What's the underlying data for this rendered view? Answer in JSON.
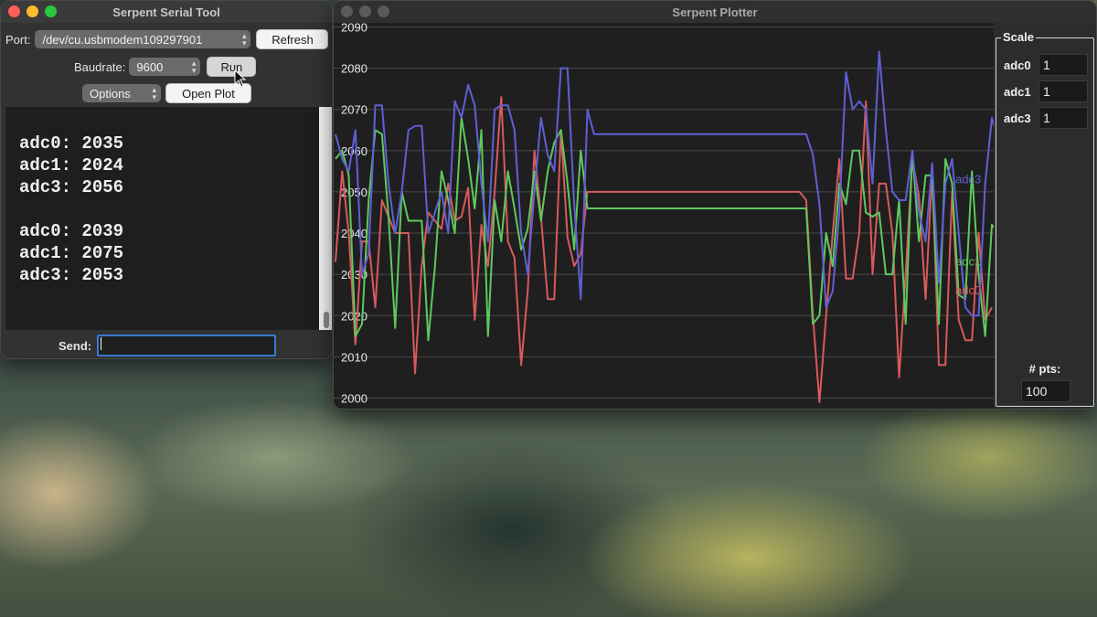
{
  "serial_tool": {
    "title": "Serpent Serial Tool",
    "port_label": "Port:",
    "port_value": "/dev/cu.usbmodem109297901",
    "refresh_label": "Refresh",
    "baud_label": "Baudrate:",
    "baud_value": "9600",
    "run_label": "Run",
    "options_value": "Options",
    "open_plot_label": "Open Plot",
    "console_lines": [
      "adc0: 2035",
      "adc1: 2024",
      "adc3: 2056",
      "",
      "adc0: 2039",
      "adc1: 2075",
      "adc3: 2053"
    ],
    "send_label": "Send:",
    "send_value": ""
  },
  "plotter": {
    "title": "Serpent Plotter",
    "scale_title": "Scale",
    "scale_rows": [
      {
        "label": "adc0",
        "value": "1"
      },
      {
        "label": "adc1",
        "value": "1"
      },
      {
        "label": "adc3",
        "value": "1"
      }
    ],
    "pts_label": "# pts:",
    "pts_value": "100"
  },
  "colors": {
    "adc0": "#d9595c",
    "adc1": "#5ec95e",
    "adc3": "#5f5fd6",
    "grid": "#4a4a4a",
    "plot_bg": "#1f1f1f"
  },
  "chart_data": {
    "type": "line",
    "ylim": [
      1997,
      2091
    ],
    "yticks": [
      2000,
      2010,
      2020,
      2030,
      2040,
      2050,
      2060,
      2070,
      2080,
      2090
    ],
    "series": [
      {
        "name": "adc0",
        "color": "#d9595c",
        "values": [
          2033,
          2055,
          2040,
          2013,
          2038,
          2038,
          2022,
          2048,
          2044,
          2040,
          2040,
          2040,
          2006,
          2032,
          2045,
          2043,
          2041,
          2052,
          2043,
          2044,
          2051,
          2019,
          2042,
          2032,
          2050,
          2073,
          2038,
          2034,
          2008,
          2026,
          2060,
          2044,
          2024,
          2024,
          2065,
          2039,
          2032,
          2035,
          2050,
          2050,
          2050,
          2050,
          2050,
          2050,
          2050,
          2050,
          2050,
          2050,
          2050,
          2050,
          2050,
          2050,
          2050,
          2050,
          2050,
          2050,
          2050,
          2050,
          2050,
          2050,
          2050,
          2050,
          2050,
          2050,
          2050,
          2050,
          2050,
          2050,
          2050,
          2050,
          2050,
          2048,
          2020,
          1999,
          2020,
          2040,
          2058,
          2029,
          2029,
          2040,
          2072,
          2030,
          2052,
          2052,
          2040,
          2005,
          2030,
          2058,
          2049,
          2024,
          2055,
          2008,
          2008,
          2050,
          2019,
          2014,
          2014,
          2040,
          2019,
          2022
        ]
      },
      {
        "name": "adc1",
        "color": "#5ec95e",
        "values": [
          2058,
          2060,
          2054,
          2015,
          2018,
          2048,
          2065,
          2064,
          2044,
          2017,
          2050,
          2043,
          2043,
          2043,
          2014,
          2032,
          2055,
          2048,
          2040,
          2068,
          2058,
          2046,
          2065,
          2015,
          2048,
          2038,
          2055,
          2046,
          2036,
          2041,
          2055,
          2043,
          2055,
          2062,
          2065,
          2052,
          2036,
          2060,
          2046,
          2046,
          2046,
          2046,
          2046,
          2046,
          2046,
          2046,
          2046,
          2046,
          2046,
          2046,
          2046,
          2046,
          2046,
          2046,
          2046,
          2046,
          2046,
          2046,
          2046,
          2046,
          2046,
          2046,
          2046,
          2046,
          2046,
          2046,
          2046,
          2046,
          2046,
          2046,
          2046,
          2046,
          2018,
          2020,
          2040,
          2032,
          2052,
          2047,
          2060,
          2060,
          2045,
          2044,
          2045,
          2030,
          2030,
          2048,
          2018,
          2060,
          2038,
          2054,
          2054,
          2018,
          2058,
          2052,
          2025,
          2024,
          2055,
          2030,
          2015,
          2042,
          2040,
          2045,
          2050,
          2048,
          2044
        ]
      },
      {
        "name": "adc3",
        "color": "#5f5fd6",
        "values": [
          2064,
          2058,
          2055,
          2065,
          2030,
          2035,
          2071,
          2071,
          2052,
          2040,
          2050,
          2065,
          2066,
          2066,
          2040,
          2045,
          2050,
          2040,
          2072,
          2068,
          2076,
          2071,
          2052,
          2038,
          2070,
          2071,
          2071,
          2065,
          2040,
          2030,
          2050,
          2068,
          2059,
          2055,
          2080,
          2080,
          2047,
          2024,
          2070,
          2064,
          2064,
          2064,
          2064,
          2064,
          2064,
          2064,
          2064,
          2064,
          2064,
          2064,
          2064,
          2064,
          2064,
          2064,
          2064,
          2064,
          2064,
          2064,
          2064,
          2064,
          2064,
          2064,
          2064,
          2064,
          2064,
          2064,
          2064,
          2064,
          2064,
          2064,
          2064,
          2064,
          2059,
          2047,
          2022,
          2026,
          2045,
          2079,
          2070,
          2072,
          2070,
          2052,
          2084,
          2065,
          2050,
          2048,
          2048,
          2060,
          2045,
          2038,
          2057,
          2028,
          2052,
          2058,
          2040,
          2022,
          2020,
          2020,
          2052,
          2068,
          2062,
          2019,
          2040
        ]
      }
    ],
    "labels_at_end": true
  }
}
